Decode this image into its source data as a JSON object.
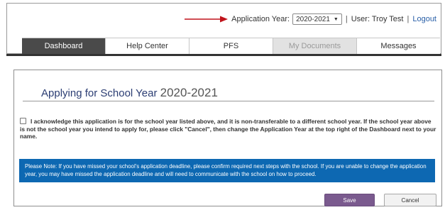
{
  "header": {
    "app_year_label": "Application Year:",
    "app_year_value": "2020-2021",
    "separator": "|",
    "user_text": "User: Troy Test",
    "logout_label": "Logout"
  },
  "tabs": [
    {
      "label": "Dashboard",
      "state": "active"
    },
    {
      "label": "Help Center",
      "state": "normal"
    },
    {
      "label": "PFS",
      "state": "normal"
    },
    {
      "label": "My Documents",
      "state": "disabled"
    },
    {
      "label": "Messages",
      "state": "normal"
    }
  ],
  "dialog": {
    "title": "Applying for School Year",
    "title_year": "2020-2021",
    "acknowledgement": "I acknowledge this application is for the school year listed above, and it is non-transferable to a different school year. If the school year above is not the school year you intend to apply for, please click \"Cancel\", then change the Application Year at the top right of the Dashboard next to your name.",
    "note": "Please Note: If you have missed your school's application deadline, please confirm required next steps with the school. If you are unable to change the application year, you may have missed the application deadline and will need to communicate with the school on how to proceed.",
    "save_label": "Save",
    "cancel_label": "Cancel"
  },
  "colors": {
    "active_tab": "#4a4a4a",
    "note_background": "#0d68b2",
    "save_button": "#7a5a8e",
    "arrow": "#c0141b",
    "title": "#2b3d73"
  }
}
